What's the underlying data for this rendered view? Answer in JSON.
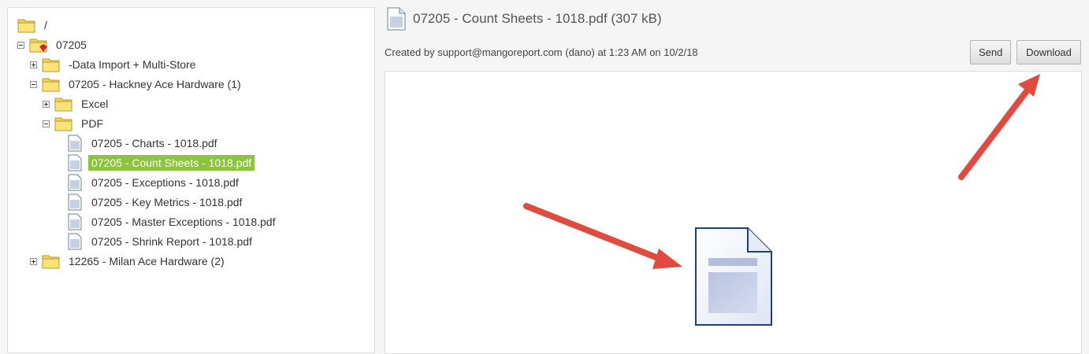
{
  "tree": {
    "items": [
      {
        "label": "/",
        "icon": "folder-icon",
        "expander": "none"
      },
      {
        "label": "07205",
        "icon": "folder-favorite-icon",
        "expander": "minus"
      },
      {
        "label": "-Data Import + Multi-Store",
        "icon": "folder-icon",
        "expander": "plus"
      },
      {
        "label": "07205 - Hackney Ace Hardware (1)",
        "icon": "folder-icon",
        "expander": "minus"
      },
      {
        "label": "Excel",
        "icon": "folder-icon",
        "expander": "plus"
      },
      {
        "label": "PDF",
        "icon": "folder-icon",
        "expander": "minus"
      },
      {
        "label": "07205 - Charts - 1018.pdf",
        "icon": "file-icon",
        "expander": "none"
      },
      {
        "label": "07205 - Count Sheets - 1018.pdf",
        "icon": "file-icon",
        "expander": "none",
        "selected": true
      },
      {
        "label": "07205 - Exceptions - 1018.pdf",
        "icon": "file-icon",
        "expander": "none"
      },
      {
        "label": "07205 - Key Metrics - 1018.pdf",
        "icon": "file-icon",
        "expander": "none"
      },
      {
        "label": "07205 - Master Exceptions - 1018.pdf",
        "icon": "file-icon",
        "expander": "none"
      },
      {
        "label": "07205 - Shrink Report - 1018.pdf",
        "icon": "file-icon",
        "expander": "none"
      },
      {
        "label": "12265 - Milan Ace Hardware (2)",
        "icon": "folder-icon",
        "expander": "plus"
      }
    ]
  },
  "detail": {
    "title": "07205 - Count Sheets - 1018.pdf (307 kB)",
    "meta": "Created by support@mangoreport.com (dano) at 1:23 AM on 10/2/18",
    "send_label": "Send",
    "download_label": "Download",
    "preview_icon": "document-icon"
  },
  "colors": {
    "selected": "#8cc43f",
    "annotation_arrow": "#e04a3f"
  }
}
